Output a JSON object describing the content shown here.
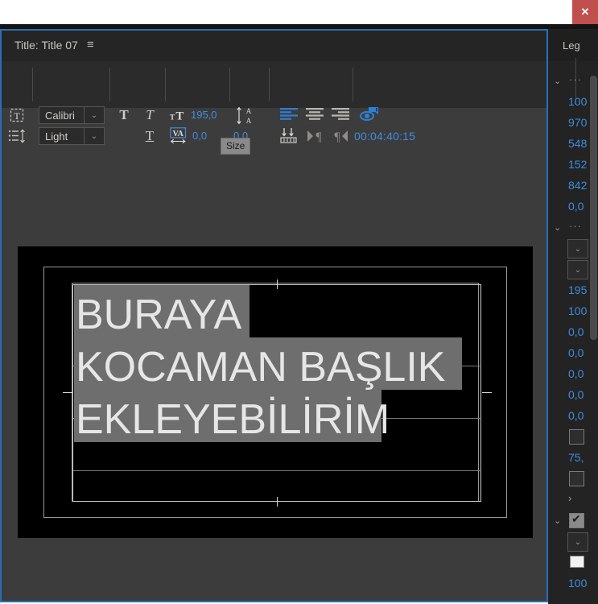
{
  "window": {
    "close_label": "✕",
    "close_color": "#c0504d"
  },
  "title_panel": {
    "header_label": "Title: Title 07",
    "menu_icon": "≡",
    "accent_color": "#2a6fb5",
    "background": "#3c3c3c"
  },
  "toolbar": {
    "tool_text_icon": "text-tool-icon",
    "tool_list_icon": "paragraph-tool-icon",
    "font_family": {
      "value": "Calibri",
      "arrow": "⌄"
    },
    "font_style": {
      "value": "Light",
      "arrow": "⌄"
    },
    "bold_label": "T",
    "italic_label": "T",
    "underline_label": "T",
    "font_size": {
      "icon": "font-size-icon",
      "value": "195,0"
    },
    "kerning": {
      "icon": "kerning-icon",
      "value": "0,0"
    },
    "leading": {
      "icon": "leading-icon",
      "value": "0,0"
    },
    "align_left": "align-left-icon",
    "align_center": "align-center-icon",
    "align_right": "align-right-icon",
    "tab_stops": "tab-stops-icon",
    "ltr": "text-ltr-icon",
    "rtl": "text-rtl-icon",
    "roll_crawl": "roll-crawl-options-icon",
    "timecode": "00:04:40:15",
    "tooltip": "Size"
  },
  "canvas": {
    "lines": [
      "BURAYA",
      "KOCAMAN BAŞLIK",
      "EKLEYEBİLİRİM"
    ],
    "text_color": "#e6e6e6",
    "selection_color": "#6e6e6e",
    "background": "#000000"
  },
  "right_panel": {
    "header_label": "Leg",
    "rows": [
      {
        "kind": "dots",
        "value": "···",
        "chevron": "⌄"
      },
      {
        "kind": "num",
        "value": "100"
      },
      {
        "kind": "num",
        "value": "970"
      },
      {
        "kind": "num",
        "value": "548"
      },
      {
        "kind": "num",
        "value": "152"
      },
      {
        "kind": "num",
        "value": "842"
      },
      {
        "kind": "num",
        "value": "0,0"
      },
      {
        "kind": "dots",
        "value": "···",
        "chevron": "⌄"
      },
      {
        "kind": "combo",
        "value": "⌄"
      },
      {
        "kind": "combo",
        "value": "⌄"
      },
      {
        "kind": "num",
        "value": "195"
      },
      {
        "kind": "num",
        "value": "100"
      },
      {
        "kind": "num",
        "value": "0,0"
      },
      {
        "kind": "num",
        "value": "0,0"
      },
      {
        "kind": "num",
        "value": "0,0"
      },
      {
        "kind": "num",
        "value": "0,0"
      },
      {
        "kind": "num",
        "value": "0,0"
      },
      {
        "kind": "check",
        "checked": false
      },
      {
        "kind": "num",
        "value": "75,"
      },
      {
        "kind": "check",
        "checked": false
      },
      {
        "kind": "arrow",
        "value": "›"
      },
      {
        "kind": "check",
        "checked": true,
        "chevron": "⌄"
      },
      {
        "kind": "combo",
        "value": "⌄"
      },
      {
        "kind": "swatch",
        "color": "#f2f2f2"
      },
      {
        "kind": "num",
        "value": "100"
      }
    ]
  }
}
